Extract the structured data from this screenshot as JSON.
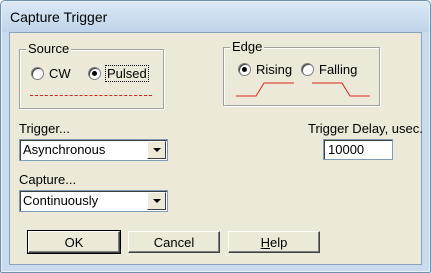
{
  "window": {
    "title": "Capture Trigger"
  },
  "source": {
    "legend": "Source",
    "options": [
      {
        "label": "CW",
        "checked": false
      },
      {
        "label": "Pulsed",
        "checked": true
      }
    ]
  },
  "edge": {
    "legend": "Edge",
    "options": [
      {
        "label": "Rising",
        "checked": true
      },
      {
        "label": "Falling",
        "checked": false
      }
    ]
  },
  "trigger": {
    "label": "Trigger...",
    "value": "Asynchronous"
  },
  "trigger_delay": {
    "label": "Trigger Delay, usec.",
    "value": "10000"
  },
  "capture": {
    "label": "Capture...",
    "value": "Continuously"
  },
  "buttons": {
    "ok": "OK",
    "cancel": "Cancel",
    "help_prefix": "H",
    "help_rest": "elp"
  },
  "colors": {
    "waveform": "#d9261c",
    "window_frame": "#c9dcef",
    "dialog_face": "#ece9d8"
  }
}
